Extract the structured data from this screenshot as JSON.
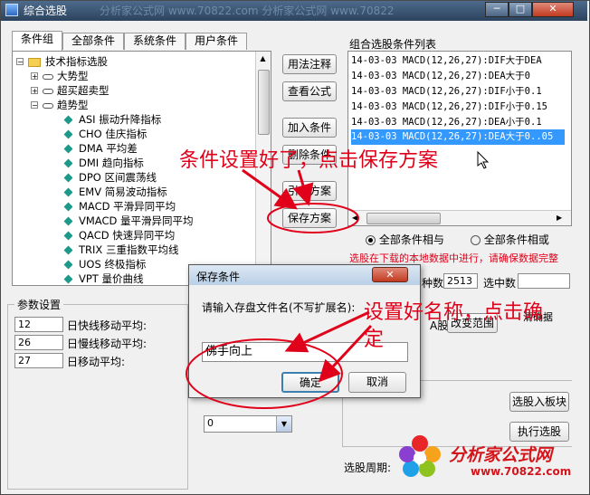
{
  "window": {
    "title": "综合选股",
    "watermark": "分析家公式网 www.70822.com    分析家公式网 www.70822"
  },
  "tabs": [
    {
      "label": "条件组"
    },
    {
      "label": "全部条件"
    },
    {
      "label": "系统条件"
    },
    {
      "label": "用户条件"
    }
  ],
  "tree": {
    "root": "技术指标选股",
    "groups": [
      "大势型",
      "超买超卖型",
      "趋势型"
    ],
    "items": [
      {
        "code": "ASI",
        "name": "振动升降指标"
      },
      {
        "code": "CHO",
        "name": "佳庆指标"
      },
      {
        "code": "DMA",
        "name": "平均差"
      },
      {
        "code": "DMI",
        "name": "趋向指标"
      },
      {
        "code": "DPO",
        "name": "区间震荡线"
      },
      {
        "code": "EMV",
        "name": "简易波动指标"
      },
      {
        "code": "MACD",
        "name": "平滑异同平均"
      },
      {
        "code": "VMACD",
        "name": "量平滑异同平均"
      },
      {
        "code": "QACD",
        "name": "快速异同平均"
      },
      {
        "code": "TRIX",
        "name": "三重指数平均线"
      },
      {
        "code": "UOS",
        "name": "终极指标"
      },
      {
        "code": "VPT",
        "name": "量价曲线"
      }
    ]
  },
  "middle_buttons": {
    "usage": "用法注释",
    "view_formula": "查看公式",
    "add": "加入条件",
    "delete": "删除条件",
    "import": "引入方案",
    "save": "保存方案"
  },
  "list": {
    "title": "组合选股条件列表",
    "rows": [
      "14-03-03 MACD(12,26,27):DIF大于DEA",
      "14-03-03 MACD(12,26,27):DEA大于0",
      "14-03-03 MACD(12,26,27):DIF小于0.1",
      "14-03-03 MACD(12,26,27):DIF小于0.15",
      "14-03-03 MACD(12,26,27):DEA小于0.1",
      "14-03-03 MACD(12,26,27):DEA大于0..05"
    ],
    "selected_index": 5
  },
  "logic": {
    "all_and": "全部条件相与",
    "all_or": "全部条件相或"
  },
  "notice": "选股在下载的本地数据中进行，请确保数据完整",
  "stats": {
    "count_label": "种数",
    "count_value": "2513",
    "selected_label": "选中数"
  },
  "params": {
    "title": "参数设置",
    "rows": [
      {
        "value": "12",
        "label": "日快线移动平均:"
      },
      {
        "value": "26",
        "label": "日慢线移动平均:"
      },
      {
        "value": "27",
        "label": "日移动平均:"
      }
    ]
  },
  "right_buttons": {
    "change_range": "改变范围",
    "a_share": "A股",
    "select_to_board": "选股入板块",
    "execute": "执行选股"
  },
  "period": {
    "label": "选股周期:",
    "value": "0"
  },
  "dialog": {
    "title": "保存条件",
    "prompt": "请输入存盘文件名(不写扩展名):",
    "filename": "佛手向上",
    "ok": "确定",
    "cancel": "取消"
  },
  "annotations": {
    "save_hint": "条件设置好了，点击保存方案",
    "name_hint_1": "设置好名称，点击确",
    "name_hint_2": "定",
    "right_fragment": "清确据"
  },
  "logo": {
    "cn": "分析家公式网",
    "url": "www.70822.com"
  },
  "colors": {
    "annotation": "#e0001a",
    "selection": "#3399ff",
    "titlebar": "#2c435e"
  }
}
